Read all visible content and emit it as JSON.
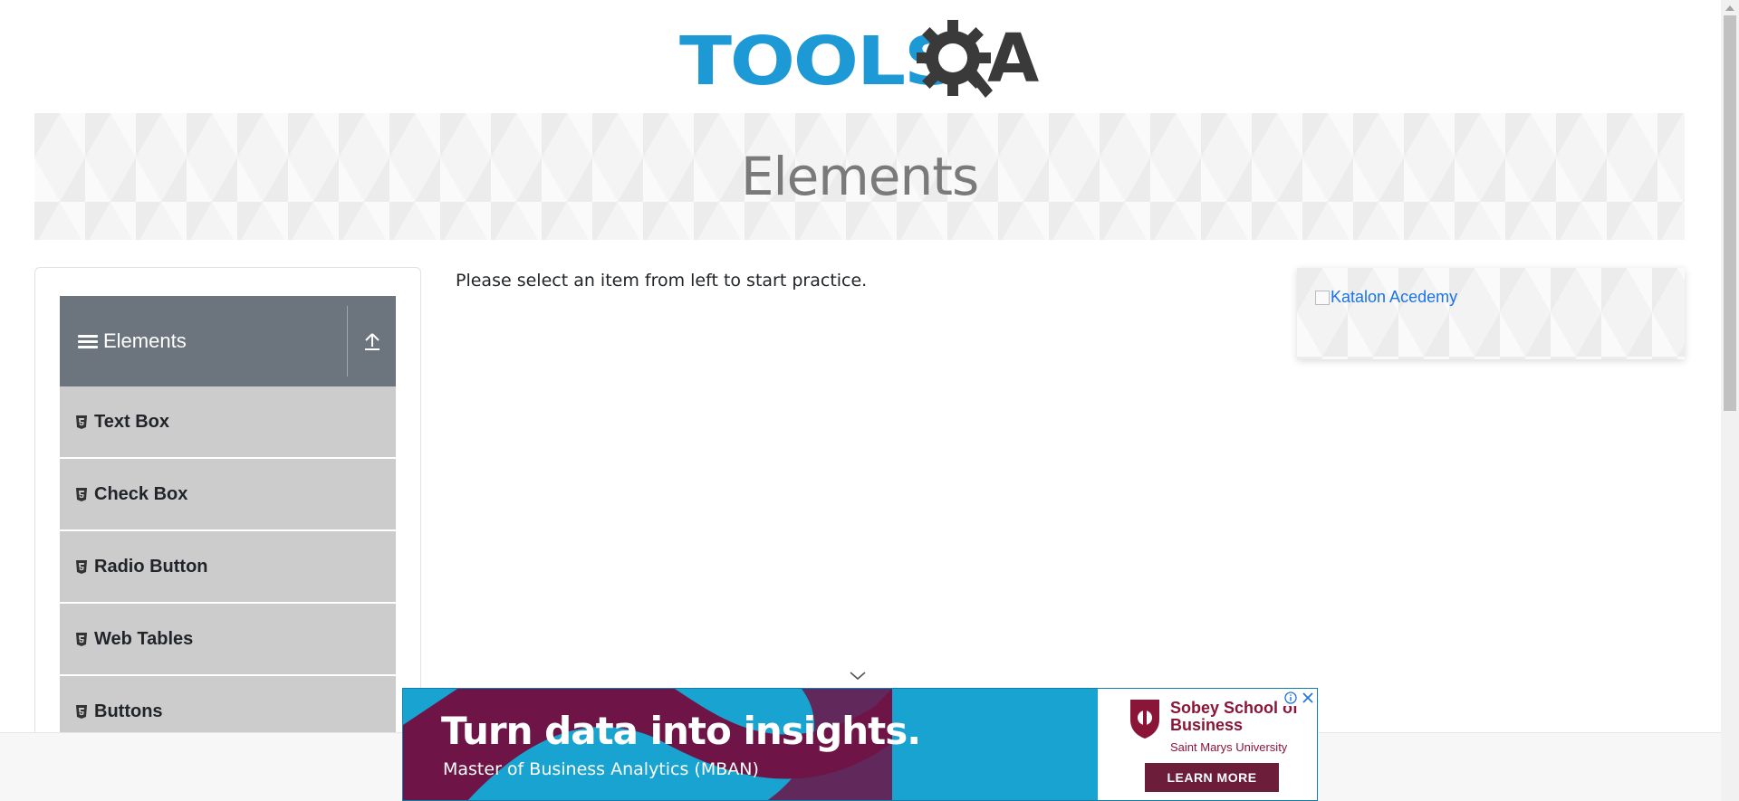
{
  "header": {
    "logo_tools": "TOOLS",
    "logo_qa_letter": "A",
    "logo_alt": "TOOLSQA"
  },
  "banner": {
    "title": "Elements"
  },
  "sidebar": {
    "group_title": "Elements",
    "group_icon": "hamburger-icon",
    "collapse_icon": "upload-arrow-icon",
    "items": [
      {
        "label": "Text Box",
        "icon": "html5-icon"
      },
      {
        "label": "Check Box",
        "icon": "html5-icon"
      },
      {
        "label": "Radio Button",
        "icon": "html5-icon"
      },
      {
        "label": "Web Tables",
        "icon": "html5-icon"
      },
      {
        "label": "Buttons",
        "icon": "html5-icon"
      }
    ]
  },
  "main": {
    "prompt": "Please select an item from left to start practice."
  },
  "side_card": {
    "link_text": "Katalon Acedemy"
  },
  "ad": {
    "headline": "Turn data into insights.",
    "subline": "Master of Business Analytics (MBAN)",
    "brand_name": "Sobey School of Business",
    "brand_university": "Saint Marys University",
    "cta": "LEARN MORE",
    "info_icon": "info-icon",
    "close_icon": "close-icon"
  },
  "colors": {
    "logo_blue": "#1d9ad6",
    "logo_dark": "#3a3a3a",
    "group_header_bg": "#6c757d",
    "menu_item_bg": "#cccccc",
    "link_blue": "#1a73e8",
    "ad_blue": "#18a3d1",
    "ad_maroon": "#8a1538"
  }
}
